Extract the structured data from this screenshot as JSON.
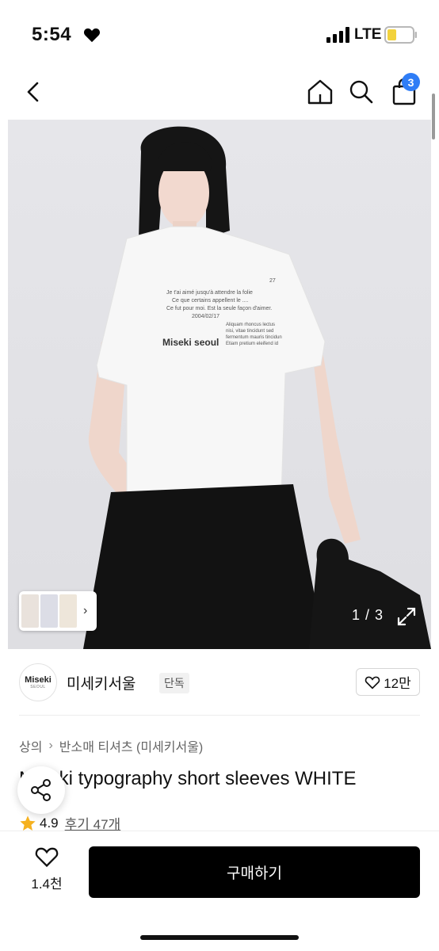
{
  "status": {
    "time": "5:54",
    "network": "LTE",
    "battery_color": "#f2d23c"
  },
  "nav": {
    "cart_count": "3",
    "badge_color": "#2f7df6"
  },
  "image": {
    "counter": "1 / 3",
    "shirt_brand_print": "Miseki seoul"
  },
  "brand": {
    "logo_main": "Miseki",
    "logo_sub": "SEOUL",
    "name": "미세키서울",
    "tag": "단독",
    "likes": "12만"
  },
  "breadcrumb": {
    "items": [
      "상의",
      "반소매 티셔츠 (미세키서울)"
    ]
  },
  "product": {
    "title": "Miseki typography short sleeves WHITE",
    "rating": "4.9",
    "reviews": "후기 47개",
    "star_color": "#f5b120"
  },
  "bottom": {
    "wish_count": "1.4천",
    "buy_label": "구매하기"
  },
  "icons": [
    "heart-icon",
    "signal-icon",
    "battery-icon",
    "back-icon",
    "home-icon",
    "search-icon",
    "bag-icon",
    "expand-icon",
    "share-icon",
    "star-icon",
    "chevron-right-icon"
  ]
}
